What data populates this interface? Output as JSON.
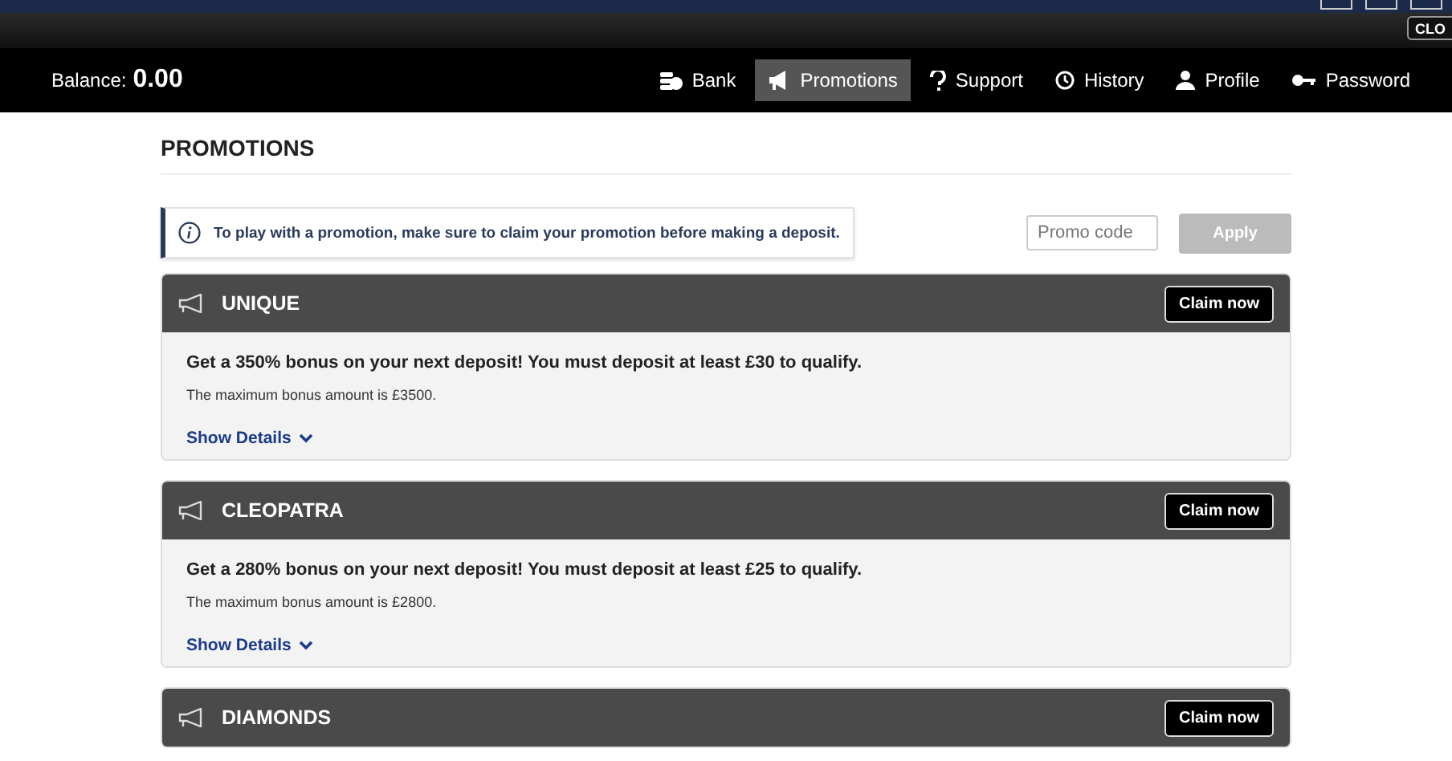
{
  "top_strip": {
    "close_label": "CLO"
  },
  "header": {
    "balance_label": "Balance:",
    "balance_value": "0.00"
  },
  "nav": [
    {
      "label": "Bank",
      "kind": "bank",
      "selected": false
    },
    {
      "label": "Promotions",
      "kind": "promotions",
      "selected": true
    },
    {
      "label": "Support",
      "kind": "support",
      "selected": false
    },
    {
      "label": "History",
      "kind": "history",
      "selected": false
    },
    {
      "label": "Profile",
      "kind": "profile",
      "selected": false
    },
    {
      "label": "Password",
      "kind": "password",
      "selected": false
    }
  ],
  "page_title": "PROMOTIONS",
  "notice": "To play with a promotion, make sure to claim your promotion before making a deposit.",
  "promo_field": {
    "placeholder": "Promo code"
  },
  "apply_button": {
    "label": "Apply",
    "disabled": true
  },
  "promotions": [
    {
      "title": "UNIQUE",
      "button": "Claim now",
      "headline": "Get a 350% bonus on your next deposit! You must deposit at least £30 to qualify.",
      "note": "The maximum bonus amount is £3500.",
      "details_link": "Show Details"
    },
    {
      "title": "CLEOPATRA",
      "button": "Claim now",
      "headline": "Get a 280% bonus on your next deposit! You must deposit at least £25 to qualify.",
      "note": "The maximum bonus amount is £2800.",
      "details_link": "Show Details"
    },
    {
      "title": "DIAMONDS",
      "button": "Claim now"
    }
  ]
}
